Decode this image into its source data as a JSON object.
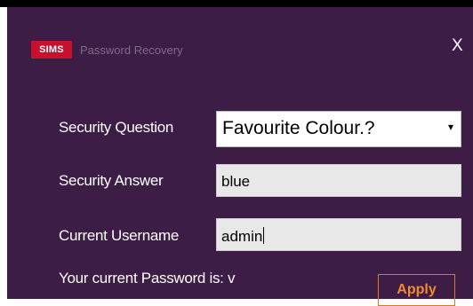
{
  "window": {
    "logo_text": "SIMS",
    "title": "Password Recovery",
    "close_label": "X"
  },
  "form": {
    "security_question_label": "Security Question",
    "security_question_value": "Favourite Colour.?",
    "dropdown_arrow": "▾",
    "security_answer_label": "Security Answer",
    "security_answer_value": "blue",
    "current_username_label": "Current Username",
    "current_username_value": "admin",
    "password_text": "Your current Password is:  v",
    "apply_label": "Apply"
  },
  "colors": {
    "dialog_background": "#3d1c45",
    "logo_red": "#c8102e",
    "apply_orange": "#f08a2a"
  }
}
